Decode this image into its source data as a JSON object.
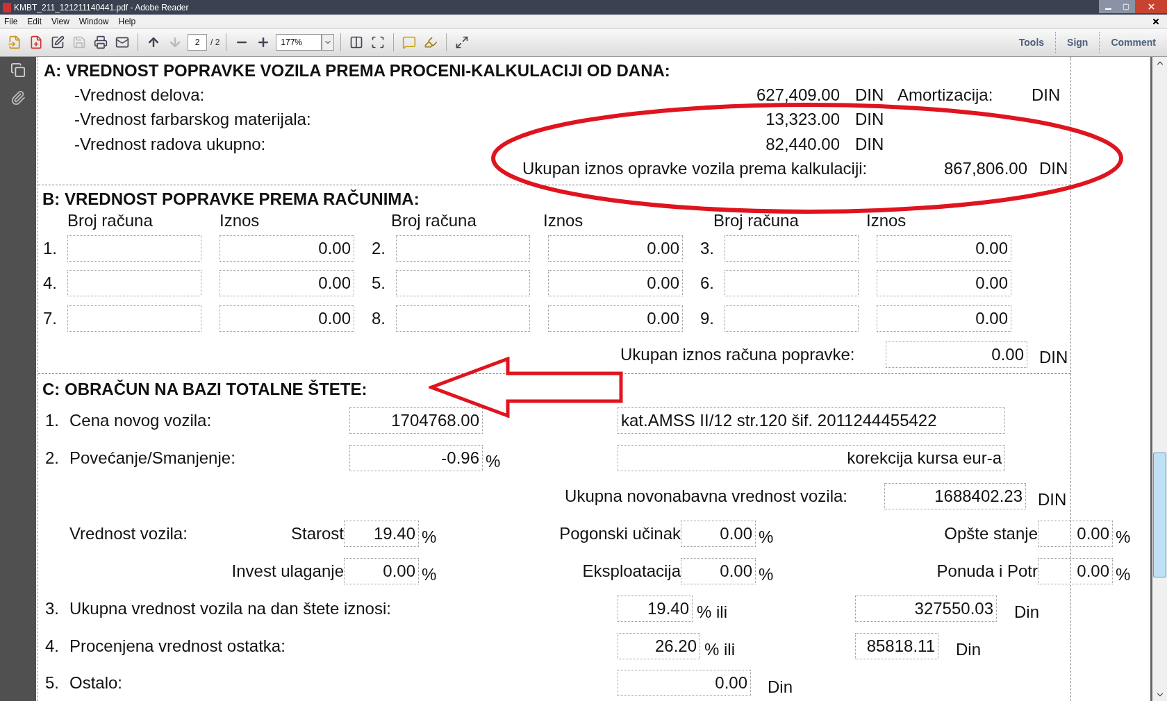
{
  "window": {
    "title": "KMBT_211_121211140441.pdf - Adobe Reader"
  },
  "menu": [
    "File",
    "Edit",
    "View",
    "Window",
    "Help"
  ],
  "toolbar": {
    "page": "2",
    "page_total": "/ 2",
    "zoom": "177%",
    "previous_disabled": false,
    "next_disabled": true,
    "panes": [
      "Tools",
      "Sign",
      "Comment"
    ]
  },
  "section_a": {
    "heading": "A:  VREDNOST POPRAVKE VOZILA PREMA PROCENI-KALKULACIJI OD DANA:",
    "items": [
      {
        "label": "-Vrednost delova:",
        "value": "627,409.00",
        "currency": "DIN"
      },
      {
        "label": "-Vrednost farbarskog materijala:",
        "value": "13,323.00",
        "currency": "DIN"
      },
      {
        "label": "-Vrednost radova ukupno:",
        "value": "82,440.00",
        "currency": "DIN"
      }
    ],
    "amortization": {
      "label": "Amortizacija:",
      "currency": "DIN"
    },
    "total": {
      "label": "Ukupan iznos opravke vozila prema kalkulaciji:",
      "value": "867,806.00",
      "currency": "DIN"
    }
  },
  "section_b": {
    "heading": "B: VREDNOST POPRAVKE PREMA RAČUNIMA:",
    "columns": [
      "Broj računa",
      "Iznos",
      "Broj računa",
      "Iznos",
      "Broj računa",
      "Iznos"
    ],
    "invoices": [
      {
        "number": "1.",
        "amount": "0.00"
      },
      {
        "number": "2.",
        "amount": "0.00"
      },
      {
        "number": "3.",
        "amount": "0.00"
      },
      {
        "number": "4.",
        "amount": "0.00"
      },
      {
        "number": "5.",
        "amount": "0.00"
      },
      {
        "number": "6.",
        "amount": "0.00"
      },
      {
        "number": "7.",
        "amount": "0.00"
      },
      {
        "number": "8.",
        "amount": "0.00"
      },
      {
        "number": "9.",
        "amount": "0.00"
      }
    ],
    "total": {
      "label": "Ukupan iznos računa popravke:",
      "value": "0.00",
      "currency": "DIN"
    }
  },
  "section_c": {
    "heading": "C: OBRAČUN NA BAZI TOTALNE ŠTETE:",
    "new_price": {
      "number": "1.",
      "label": "Cena novog vozila:",
      "value": "1704768.00",
      "note": "kat.AMSS II/12 str.120 šif. 2011244455422"
    },
    "adjustment": {
      "number": "2.",
      "label": "Povećanje/Smanjenje:",
      "value": "-0.96",
      "unit": "%",
      "note": "korekcija kursa eur-a"
    },
    "replacement": {
      "label": "Ukupna novonabavna vrednost vozila:",
      "value": "1688402.23",
      "currency": "DIN"
    },
    "vehicle_value_label": "Vrednost vozila:",
    "factors": [
      [
        {
          "label": "Starost",
          "value": "19.40",
          "unit": "%"
        },
        {
          "label": "Pogonski učinak",
          "value": "0.00",
          "unit": "%"
        },
        {
          "label": "Opšte stanje",
          "value": "0.00",
          "unit": "%"
        }
      ],
      [
        {
          "label": "Invest ulaganje",
          "value": "0.00",
          "unit": "%"
        },
        {
          "label": "Eksploatacija",
          "value": "0.00",
          "unit": "%"
        },
        {
          "label": "Ponuda i Potr",
          "value": "0.00",
          "unit": "%"
        }
      ]
    ],
    "damage_day": {
      "number": "3.",
      "label": "Ukupna vrednost vozila na dan štete iznosi:",
      "percent": "19.40",
      "unit": "% ili",
      "amount": "327550.03",
      "currency": "Din"
    },
    "remainder": {
      "number": "4.",
      "label": "Procenjena vrednost ostatka:",
      "percent": "26.20",
      "unit": "% ili",
      "amount": "85818.11",
      "currency": "Din"
    },
    "other": {
      "number": "5.",
      "label": "Ostalo:",
      "value": "0.00",
      "currency": "Din"
    }
  }
}
